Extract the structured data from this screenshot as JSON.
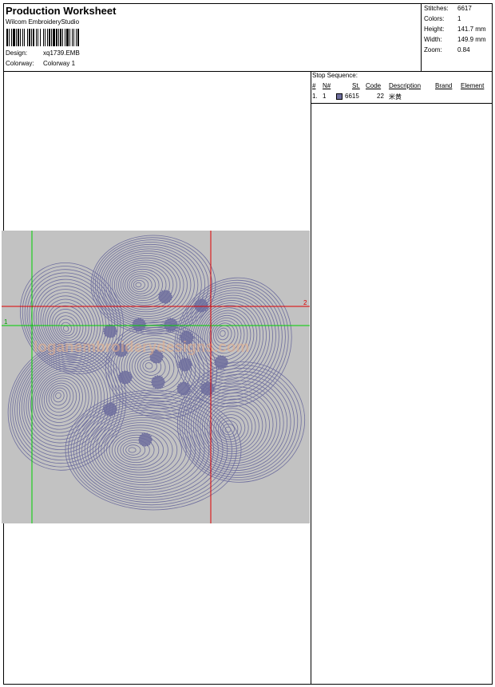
{
  "header": {
    "title": "Production Worksheet",
    "software": "Wilcom EmbroideryStudio",
    "design_label": "Design:",
    "design_value": "xq1739.EMB",
    "colorway_label": "Colorway:",
    "colorway_value": "Colorway 1"
  },
  "stats": [
    {
      "label": "Stitches:",
      "value": "6617"
    },
    {
      "label": "Colors:",
      "value": "1"
    },
    {
      "label": "Height:",
      "value": "141.7 mm"
    },
    {
      "label": "Width:",
      "value": "149.9 mm"
    },
    {
      "label": "Zoom:",
      "value": "0.84"
    }
  ],
  "preview": {
    "watermark": "loganembroiderydesigns.com",
    "marker_1": "1",
    "marker_2": "2",
    "thread_color": "#6e6e9e",
    "background_color": "#c2c2c2"
  },
  "stop_sequence": {
    "title": "Stop Sequence:",
    "headers": {
      "num": "#",
      "n": "N#",
      "st": "St.",
      "code": "Code",
      "description": "Description",
      "brand": "Brand",
      "element": "Element"
    },
    "rows": [
      {
        "num": "1.",
        "n": "1",
        "st": "6615",
        "code": "22",
        "description": "米黄",
        "brand": "",
        "element": ""
      }
    ]
  }
}
